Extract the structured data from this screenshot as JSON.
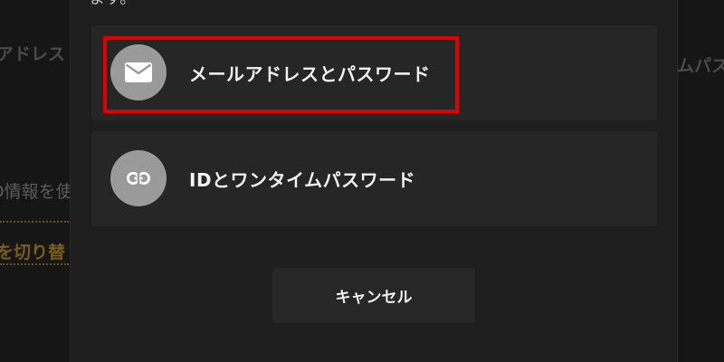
{
  "background": {
    "left_heading": "アドレス",
    "right_heading": "ムパス",
    "left_info": "D情報を使",
    "left_link": "を切り替"
  },
  "dialog": {
    "top_text": "ます。",
    "options": [
      {
        "label": "メールアドレスとパスワード",
        "icon": "mail-icon"
      },
      {
        "label": "IDとワンタイムパスワード",
        "icon": "link-icon"
      }
    ],
    "cancel_label": "キャンセル",
    "highlight_color": "#e00000"
  }
}
